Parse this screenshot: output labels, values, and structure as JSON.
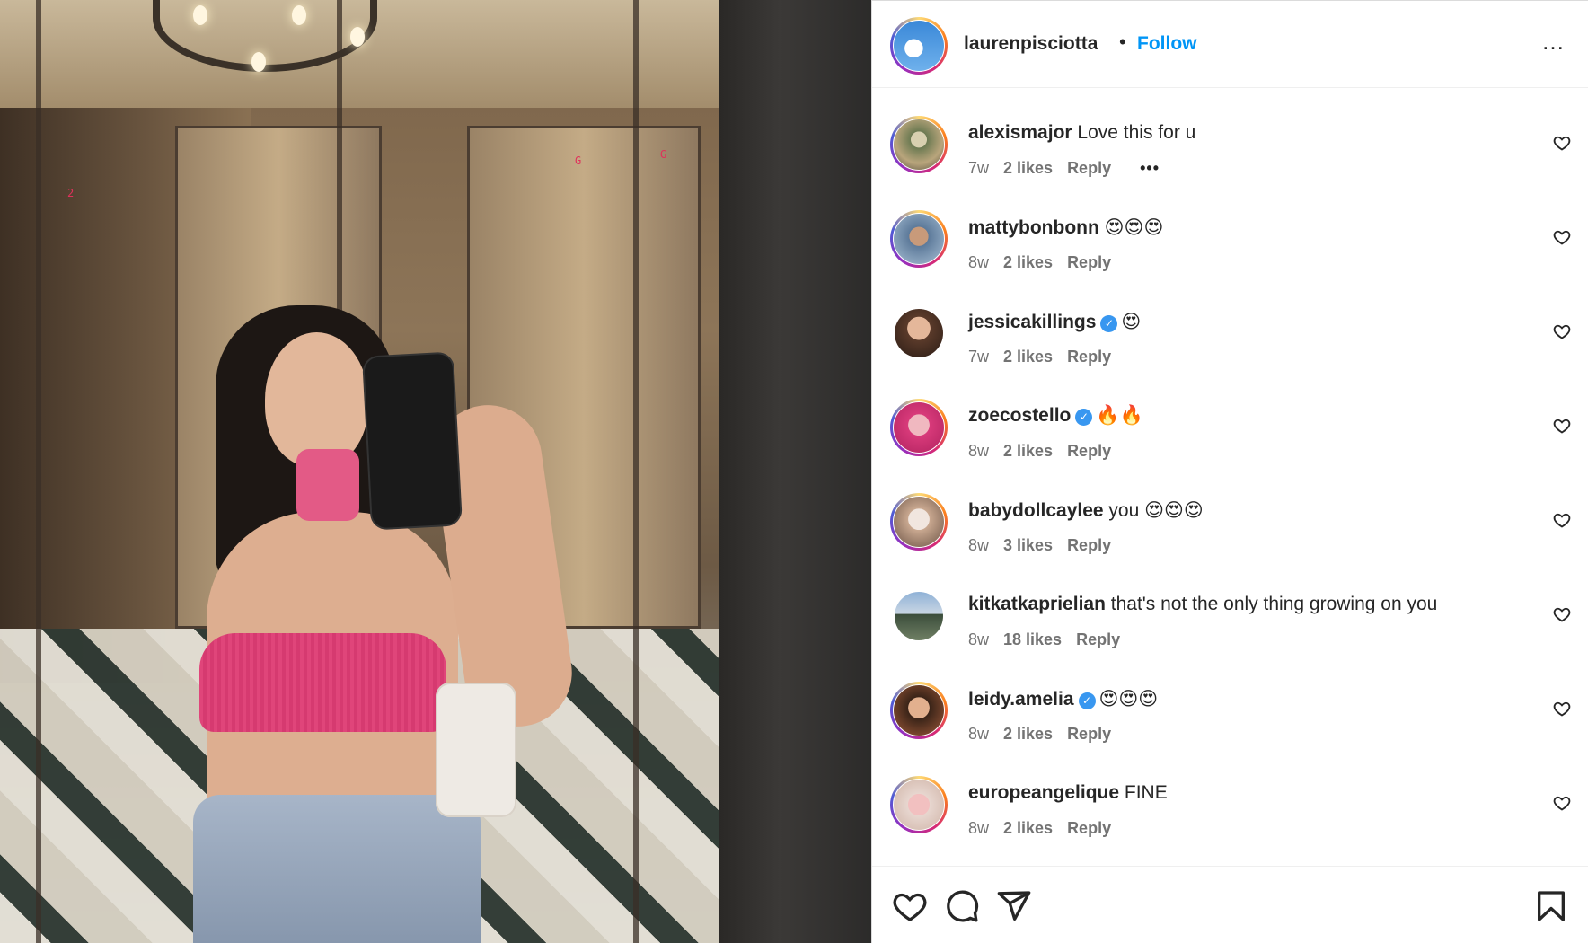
{
  "post": {
    "owner": "laurenpisciotta",
    "separator": "•",
    "follow_label": "Follow",
    "more_icon": "…",
    "photo_indicators": [
      "2",
      "G",
      "G"
    ]
  },
  "comments": [
    {
      "user": "alexismajor",
      "verified": false,
      "text": "Love this for u",
      "age": "7w",
      "likes": "2 likes",
      "reply": "Reply",
      "more": "•••",
      "avatar": "ring"
    },
    {
      "user": "mattybonbonn",
      "verified": false,
      "text": "😍😍😍",
      "age": "8w",
      "likes": "2 likes",
      "reply": "Reply",
      "avatar": "ring"
    },
    {
      "user": "jessicakillings",
      "verified": true,
      "text": "😍",
      "age": "7w",
      "likes": "2 likes",
      "reply": "Reply",
      "avatar": "plain"
    },
    {
      "user": "zoecostello",
      "verified": true,
      "text": "🔥🔥",
      "age": "8w",
      "likes": "2 likes",
      "reply": "Reply",
      "avatar": "ring"
    },
    {
      "user": "babydollcaylee",
      "verified": false,
      "text": "you 😍😍😍",
      "age": "8w",
      "likes": "3 likes",
      "reply": "Reply",
      "avatar": "ring"
    },
    {
      "user": "kitkatkaprielian",
      "verified": false,
      "text": "that's not the only thing growing on you",
      "age": "8w",
      "likes": "18 likes",
      "reply": "Reply",
      "avatar": "plain"
    },
    {
      "user": "leidy.amelia",
      "verified": true,
      "text": "😍😍😍",
      "age": "8w",
      "likes": "2 likes",
      "reply": "Reply",
      "avatar": "ring"
    },
    {
      "user": "europeangelique",
      "verified": false,
      "text": "FINE",
      "age": "8w",
      "likes": "2 likes",
      "reply": "Reply",
      "avatar": "ring"
    }
  ],
  "icons": {
    "verified": "✓",
    "like": "heart-icon",
    "comment": "comment-icon",
    "share": "share-icon",
    "save": "bookmark-icon"
  },
  "colors": {
    "follow": "#0095f6",
    "verified": "#3897f0",
    "text": "#262626",
    "meta": "#737373"
  }
}
